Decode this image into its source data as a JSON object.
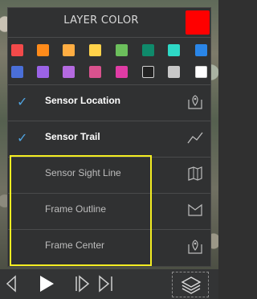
{
  "panel": {
    "title": "LAYER COLOR",
    "selected_color": "#ff0000"
  },
  "palette": [
    [
      "#f24a4a",
      "#ff8b1a",
      "#ffad42",
      "#ffd24a",
      "#6cbf5c",
      "#0f8a6b",
      "#2ed9c6",
      "#2a86e8"
    ],
    [
      "#4a6fd8",
      "#9b63e6",
      "#b46ae0",
      "#d9528e",
      "#e03ca5",
      "#222222",
      "#c8c8c8",
      "#ffffff"
    ]
  ],
  "layers": [
    {
      "label": "Sensor Location",
      "checked": true,
      "icon": "map-pin-icon"
    },
    {
      "label": "Sensor Trail",
      "checked": true,
      "icon": "trail-line-icon"
    },
    {
      "label": "Sensor Sight Line",
      "checked": false,
      "icon": "map-sightline-icon"
    },
    {
      "label": "Frame Outline",
      "checked": false,
      "icon": "frame-outline-icon"
    },
    {
      "label": "Frame Center",
      "checked": false,
      "icon": "map-pin-icon"
    }
  ],
  "toolbar": {
    "buttons": [
      "step-back-icon",
      "play-icon",
      "step-forward-icon",
      "skip-end-icon",
      "layers-icon"
    ]
  }
}
